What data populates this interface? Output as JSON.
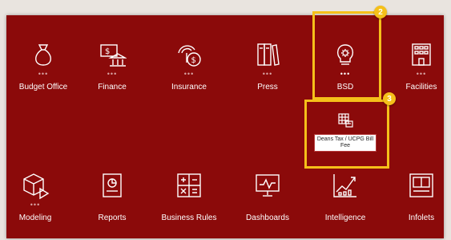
{
  "tiles_row1": [
    {
      "label": "Budget Office",
      "icon": "money-bag-icon"
    },
    {
      "label": "Finance",
      "icon": "finance-bank-icon"
    },
    {
      "label": "Insurance",
      "icon": "insurance-icon"
    },
    {
      "label": "Press",
      "icon": "press-books-icon"
    },
    {
      "label": "BSD",
      "icon": "lightbulb-icon"
    },
    {
      "label": "Facilities",
      "icon": "building-icon"
    }
  ],
  "tiles_row2": [
    {
      "label": "Modeling",
      "icon": "modeling-cube-icon"
    },
    {
      "label": "Reports",
      "icon": "report-chart-icon"
    },
    {
      "label": "Business Rules",
      "icon": "calculator-icon"
    },
    {
      "label": "Dashboards",
      "icon": "monitor-chart-icon"
    },
    {
      "label": "Intelligence",
      "icon": "trend-chart-icon"
    },
    {
      "label": "Infolets",
      "icon": "infolets-icon"
    }
  ],
  "dots": "•••",
  "submenu": {
    "label": "Deans Tax / UCPG Bill Fee",
    "icon": "table-grid-icon"
  },
  "callouts": {
    "badge_2": "2",
    "badge_3": "3"
  },
  "colors": {
    "panel": "#8b0a0a",
    "highlight": "#f5c01a"
  }
}
